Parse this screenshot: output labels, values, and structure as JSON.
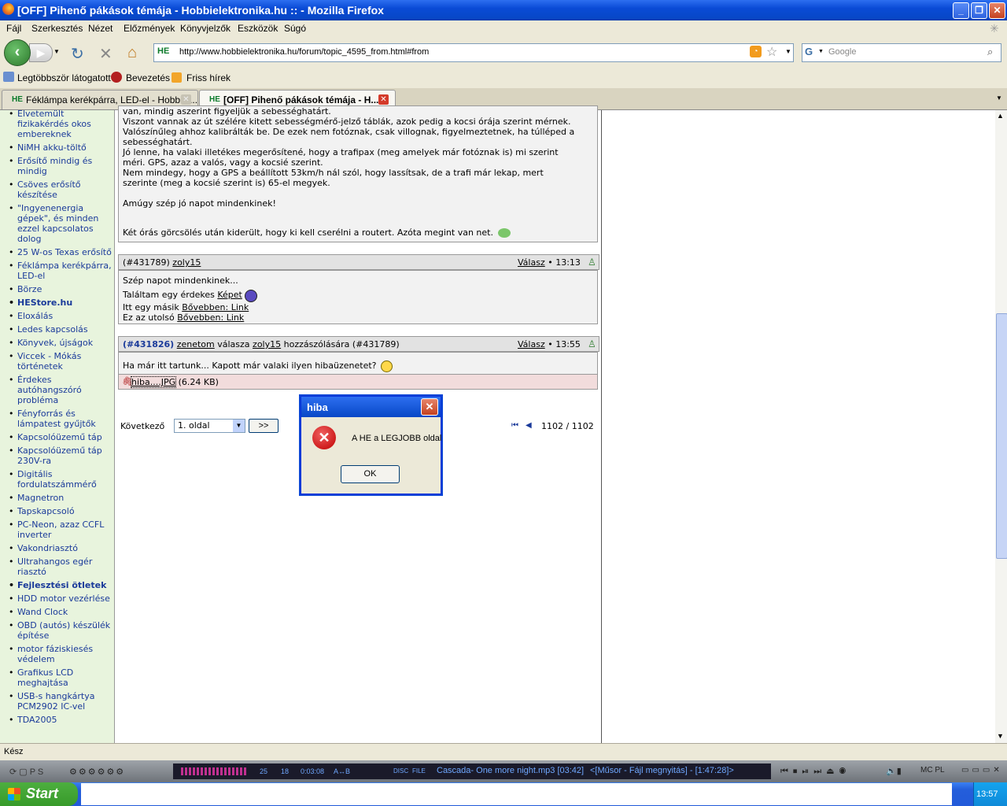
{
  "window": {
    "title": "[OFF] Pihenő pákások témája - Hobbielektronika.hu :: - Mozilla Firefox"
  },
  "menu": [
    "Fájl",
    "Szerkesztés",
    "Nézet",
    "Előzmények",
    "Könyvjelzők",
    "Eszközök",
    "Súgó"
  ],
  "navbar": {
    "url": "http://www.hobbielektronika.hu/forum/topic_4595_from.html#from",
    "site_badge": "HE",
    "search_placeholder": "Google"
  },
  "bookmarks": [
    "Legtöbbször látogatott",
    "Bevezetés",
    "Friss hírek"
  ],
  "tabs": [
    {
      "label": "Féklámpa kerékpárra, LED-el - Hobbiel...",
      "active": false
    },
    {
      "label": "[OFF] Pihenő pákások témája - H...",
      "active": true
    }
  ],
  "sidebar": {
    "items": [
      {
        "label": "Elvetemült fizikakérdés okos embereknek",
        "bold": false
      },
      {
        "label": "NiMH akku-töltő",
        "bold": false
      },
      {
        "label": "Erősítő mindig és mindig",
        "bold": false
      },
      {
        "label": "Csöves erősítő készítése",
        "bold": false
      },
      {
        "label": "\"Ingyenenergia gépek\", és minden ezzel kapcsolatos dolog",
        "bold": false
      },
      {
        "label": "25 W-os Texas erősítő",
        "bold": false
      },
      {
        "label": "Féklámpa kerékpárra, LED-el",
        "bold": false
      },
      {
        "label": "Börze",
        "bold": false
      },
      {
        "label": "HEStore.hu",
        "bold": true
      },
      {
        "label": "Eloxálás",
        "bold": false
      },
      {
        "label": "Ledes kapcsolás",
        "bold": false
      },
      {
        "label": "Könyvek, újságok",
        "bold": false
      },
      {
        "label": "Viccek - Mókás történetek",
        "bold": false
      },
      {
        "label": "Érdekes autóhangszóró probléma",
        "bold": false
      },
      {
        "label": "Fényforrás és lámpatest gyűjtők",
        "bold": false
      },
      {
        "label": "Kapcsolóüzemű táp",
        "bold": false
      },
      {
        "label": "Kapcsolóüzemű táp 230V-ra",
        "bold": false
      },
      {
        "label": "Digitális fordulatszámmérő",
        "bold": false
      },
      {
        "label": "Magnetron",
        "bold": false
      },
      {
        "label": "Tapskapcsoló",
        "bold": false
      },
      {
        "label": "PC-Neon, azaz CCFL inverter",
        "bold": false
      },
      {
        "label": "Vakondriasztó",
        "bold": false
      },
      {
        "label": "Ultrahangos egér riasztó",
        "bold": false
      },
      {
        "label": "Fejlesztési ötletek",
        "bold": true
      },
      {
        "label": "HDD motor vezérlése",
        "bold": false
      },
      {
        "label": "Wand Clock",
        "bold": false
      },
      {
        "label": "OBD (autós) készülék építése",
        "bold": false
      },
      {
        "label": "motor fáziskiesés védelem",
        "bold": false
      },
      {
        "label": "Grafikus LCD meghajtása",
        "bold": false
      },
      {
        "label": "USB-s hangkártya PCM2902 IC-vel",
        "bold": false
      },
      {
        "label": "TDA2005",
        "bold": false
      }
    ]
  },
  "post1": {
    "lines": [
      "van, mindig aszerint figyeljük a sebességhatárt.",
      "Viszont vannak az út szélére kitett sebességmérő-jelző táblák, azok pedig a kocsi órája szerint mérnek.",
      "Valószínűleg ahhoz kalibrálták be. De ezek nem fotóznak, csak villognak, figyelmeztetnek, ha túlléped a",
      "sebességhatárt.",
      "Jó lenne, ha valaki illetékes megerősítené, hogy a trafipax (meg amelyek már fotóznak is) mi szerint",
      "méri. GPS, azaz a valós, vagy a kocsié szerint.",
      "Nem mindegy, hogy a GPS a beállított 53km/h nál szól, hogy lassítsak, de a trafi már lekap, mert",
      "szerinte (meg a kocsié szerint is) 65-el megyek.",
      "",
      "Amúgy szép jó napot mindenkinek!",
      "",
      ""
    ],
    "footer": "Két órás görcsölés után kiderült, hogy ki kell cserélni a routert. Azóta megint van net."
  },
  "post2": {
    "id": "(#431789)",
    "author": "zoly15",
    "reply": "Válasz",
    "time": "• 13:13",
    "line1": "Szép napot mindenkinek...",
    "line2_prefix": "Találtam egy érdekes",
    "line2_link": "Képet",
    "line3_prefix": "Itt egy másik",
    "line3_link": "Bővebben: Link",
    "line4_prefix": "Ez az utolsó",
    "line4_link": "Bővebben: Link"
  },
  "post3": {
    "id": "(#431826)",
    "author": "zenetom",
    "mid": "válasza",
    "replyto": "zoly15",
    "suffix": "hozzászólására (#431789)",
    "reply": "Válasz",
    "time": "• 13:55",
    "text": "Ha már itt tartunk... Kapott már valaki ilyen hibaüzenetet?",
    "attachment": "hiba....JPG",
    "attachment_size": "(6.24 KB)"
  },
  "pager": {
    "next_label": "Következő",
    "select_value": "1. oldal",
    "go_label": ">>",
    "page_info": "1102 / 1102"
  },
  "dialog": {
    "title": "hiba",
    "message": "A HE a LEGJOBB oldal",
    "ok": "OK"
  },
  "status": "Kész",
  "media": {
    "counter1": "25",
    "counter2": "18",
    "elapsed": "0:03:08",
    "ab": "A↔B",
    "disc": "DISC",
    "file": "FILE",
    "track": "Cascada- One more night.mp3  [03:42]",
    "playlist": "<[Műsor - Fájl megnyitás] - [1:47:28]>"
  },
  "taskbar": {
    "start": "Start",
    "clock": "13:57"
  }
}
